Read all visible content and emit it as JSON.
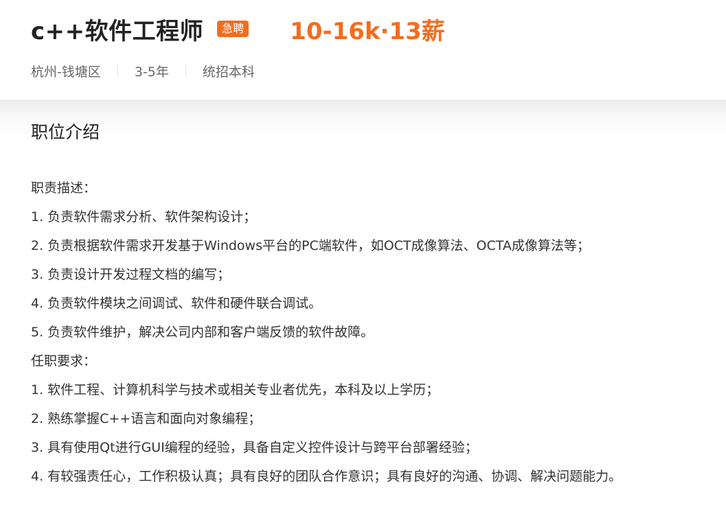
{
  "job": {
    "title": "c++软件工程师",
    "badge": "急聘",
    "salary": "10-16k·13薪"
  },
  "meta": {
    "location": "杭州-钱塘区",
    "experience": "3-5年",
    "education": "统招本科"
  },
  "section": {
    "title": "职位介绍"
  },
  "description": {
    "lines": [
      "职责描述：",
      "1. 负责软件需求分析、软件架构设计；",
      "2. 负责根据软件需求开发基于Windows平台的PC端软件，如OCT成像算法、OCTA成像算法等；",
      "3. 负责设计开发过程文档的编写；",
      "4. 负责软件模块之间调试、软件和硬件联合调试。",
      "5. 负责软件维护，解决公司内部和客户端反馈的软件故障。",
      "任职要求：",
      "1. 软件工程、计算机科学与技术或相关专业者优先，本科及以上学历；",
      "2. 熟练掌握C++语言和面向对象编程；",
      "3. 具有使用Qt进行GUI编程的经验，具备自定义控件设计与跨平台部署经验；",
      "4. 有较强责任心，工作积极认真；具有良好的团队合作意识；具有良好的沟通、协调、解决问题能力。"
    ]
  },
  "colors": {
    "accent": "#f26d1f",
    "title": "#222222",
    "text": "#333333",
    "meta": "#666666"
  }
}
